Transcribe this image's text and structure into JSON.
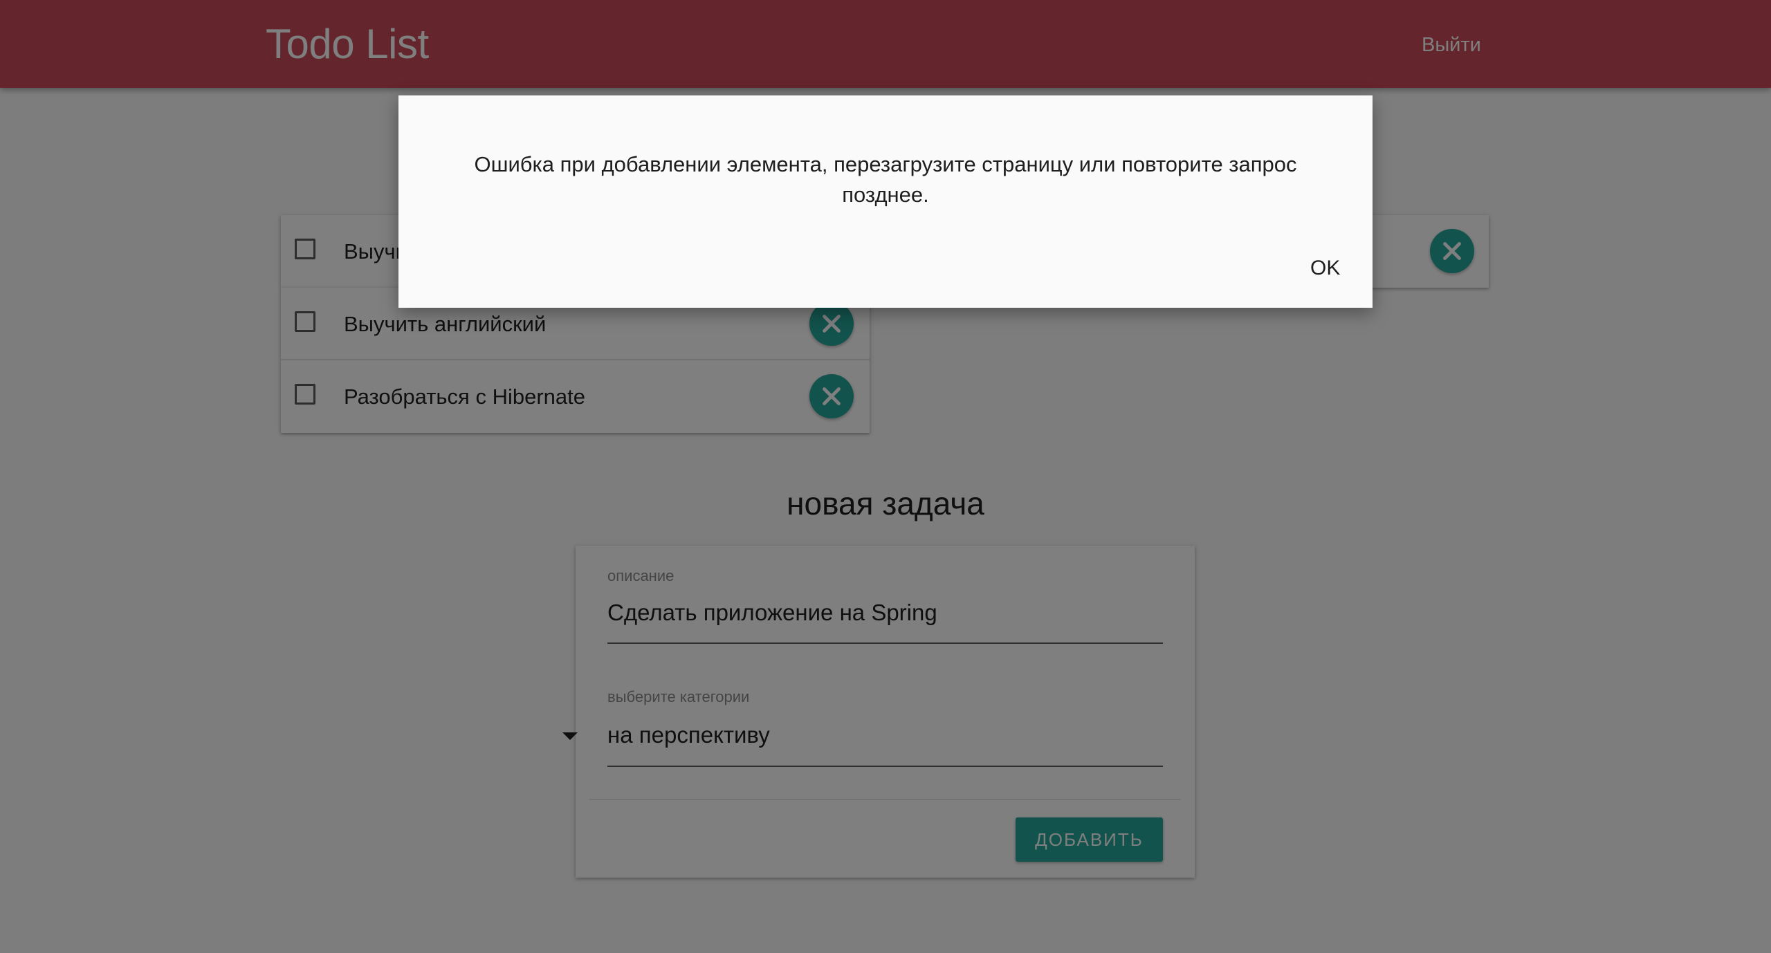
{
  "header": {
    "title": "Todo List",
    "logout_label": "Выйти",
    "background": "#c94a58"
  },
  "todos": [
    {
      "label": "Выучи",
      "checked": false
    },
    {
      "label": "Выучить английский",
      "checked": false
    },
    {
      "label": "Разобраться с Hibernate",
      "checked": false
    }
  ],
  "new_task": {
    "title": "новая задача",
    "description_label": "описание",
    "description_value": "Сделать приложение на Spring",
    "category_label": "выберите категории",
    "category_value": "на перспективу",
    "submit_label": "ДОБАВИТЬ"
  },
  "dialog": {
    "message": "Ошибка при добавлении элемента, перезагрузите страницу или повторите запрос позднее.",
    "ok_label": "OK"
  },
  "colors": {
    "accent": "#26a69a",
    "header": "#c94a58",
    "overlay": "rgba(0,0,0,0.5)"
  },
  "icons": {
    "delete": "close-icon",
    "dropdown": "chevron-down-icon"
  }
}
